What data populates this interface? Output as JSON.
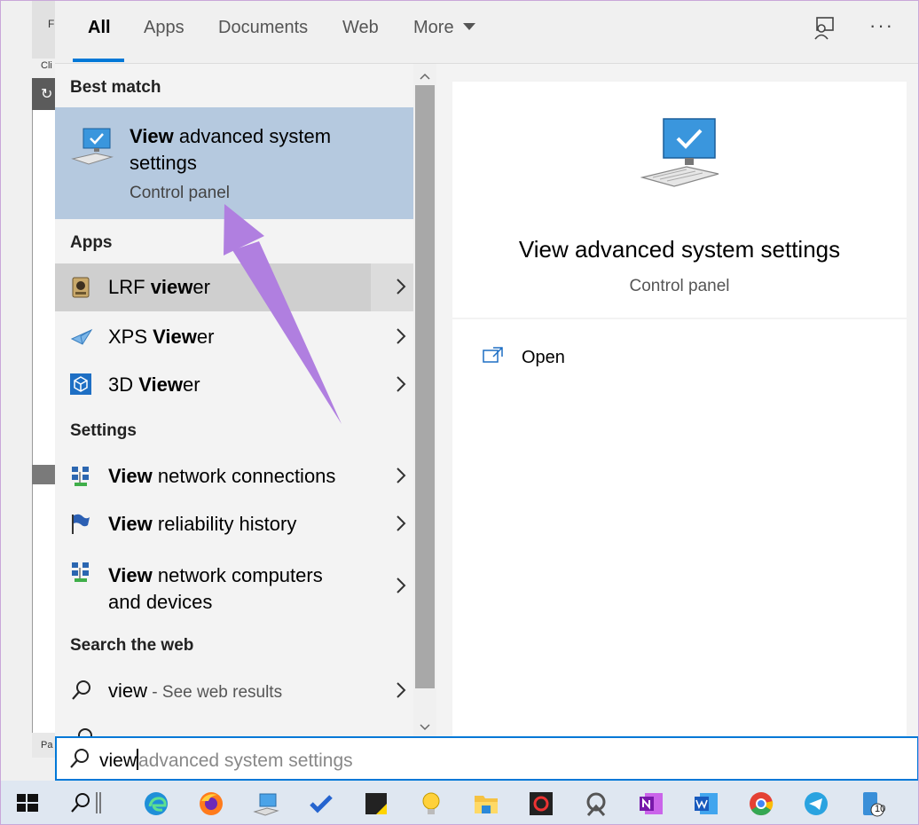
{
  "background_app": {
    "label_top": "F",
    "label_cli": "Cli",
    "label_pa": "Pa"
  },
  "tabs": [
    {
      "label": "All",
      "active": true
    },
    {
      "label": "Apps"
    },
    {
      "label": "Documents"
    },
    {
      "label": "Web"
    },
    {
      "label": "More"
    }
  ],
  "tab_icons": [
    "feedback-icon",
    "more-options-icon"
  ],
  "more_dots": "···",
  "results": {
    "best_match_header": "Best match",
    "best_match": {
      "title_bold": "View",
      "title_rest": " advanced system settings",
      "subtitle": "Control panel",
      "icon": "computer-monitor-icon"
    },
    "apps_header": "Apps",
    "apps": [
      {
        "bold_prefix": "",
        "label_pre": "LRF ",
        "label_bold": "view",
        "label_post": "er",
        "icon": "lrf-viewer-icon"
      },
      {
        "label_pre": "XPS ",
        "label_bold": "View",
        "label_post": "er",
        "icon": "xps-viewer-icon"
      },
      {
        "label_pre": "3D ",
        "label_bold": "View",
        "label_post": "er",
        "icon": "3d-viewer-icon"
      }
    ],
    "settings_header": "Settings",
    "settings": [
      {
        "label_bold": "View",
        "label_post": " network connections",
        "icon": "network-icon"
      },
      {
        "label_bold": "View",
        "label_post": " reliability history",
        "icon": "flag-icon"
      },
      {
        "label_bold": "View",
        "label_post": " network computers",
        "label_line2": "and devices",
        "icon": "network-icon"
      }
    ],
    "web_header": "Search the web",
    "web": [
      {
        "query": "view",
        "suffix": " - See web results",
        "icon": "search-icon"
      }
    ]
  },
  "preview": {
    "title": "View advanced system settings",
    "subtitle": "Control panel",
    "action_open": "Open",
    "icon": "computer-monitor-icon"
  },
  "searchbox": {
    "typed": "view",
    "autocomplete": "advanced system settings",
    "icon": "search-icon"
  },
  "taskbar": {
    "items": [
      "windows-start-icon",
      "search-icon",
      "divider",
      "edge-icon",
      "firefox-icon",
      "remote-desktop-icon",
      "todo-icon",
      "sticky-notes-icon",
      "tips-icon",
      "file-explorer-icon",
      "obs-icon",
      "app-icon",
      "onenote-icon",
      "word-icon",
      "chrome-icon",
      "telegram-icon",
      "phone-icon"
    ],
    "phone_badge": "10"
  },
  "colors": {
    "accent": "#0078d7",
    "selected": "#b5c9df",
    "annotation_arrow": "#b07fe0"
  }
}
